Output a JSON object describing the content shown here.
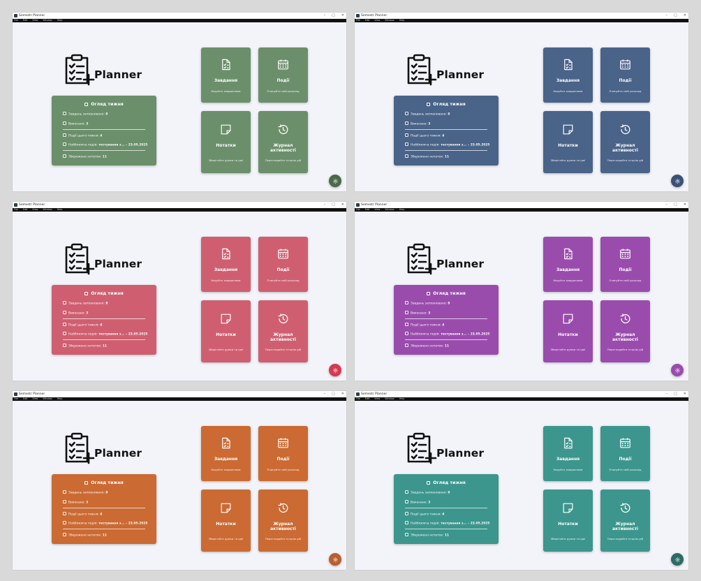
{
  "app": {
    "window_title": "Semestr Planner",
    "logo_text": "Planner",
    "menu": [
      "File",
      "Edit",
      "View",
      "Window",
      "Help"
    ]
  },
  "overview": {
    "title": "Огляд тижня",
    "tasks_label": "Завдань заплановано:",
    "tasks_value": "8",
    "done_label": "Виконано:",
    "done_value": "3",
    "events_label": "Події цього тижня:",
    "events_value": "4",
    "nearest_label": "Найближча подія:",
    "nearest_value": "тестування з... – 23.05.2025",
    "notes_label": "Збережено нотаток:",
    "notes_value": "11"
  },
  "tiles": {
    "tasks": {
      "title": "Завдання",
      "subtitle": "Керуйте завданнями"
    },
    "events": {
      "title": "Події",
      "subtitle": "Плануйте свій розклад"
    },
    "notes": {
      "title": "Нотатки",
      "subtitle": "Зберігайте думки та ідеї"
    },
    "journal": {
      "title": "Журнал активності",
      "subtitle": "Переглядайте історію дій"
    }
  },
  "themes": [
    {
      "name": "green",
      "color": "#6b8f6b",
      "fab": "#4a6a4a"
    },
    {
      "name": "blue",
      "color": "#4a6388",
      "fab": "#3a5075"
    },
    {
      "name": "red",
      "color": "#cf5f70",
      "fab": "#d43a50"
    },
    {
      "name": "purple",
      "color": "#9a4cad",
      "fab": "#9a4cad"
    },
    {
      "name": "orange",
      "color": "#cb6a33",
      "fab": "#b85e2f"
    },
    {
      "name": "teal",
      "color": "#3c968d",
      "fab": "#2c6a64"
    }
  ]
}
